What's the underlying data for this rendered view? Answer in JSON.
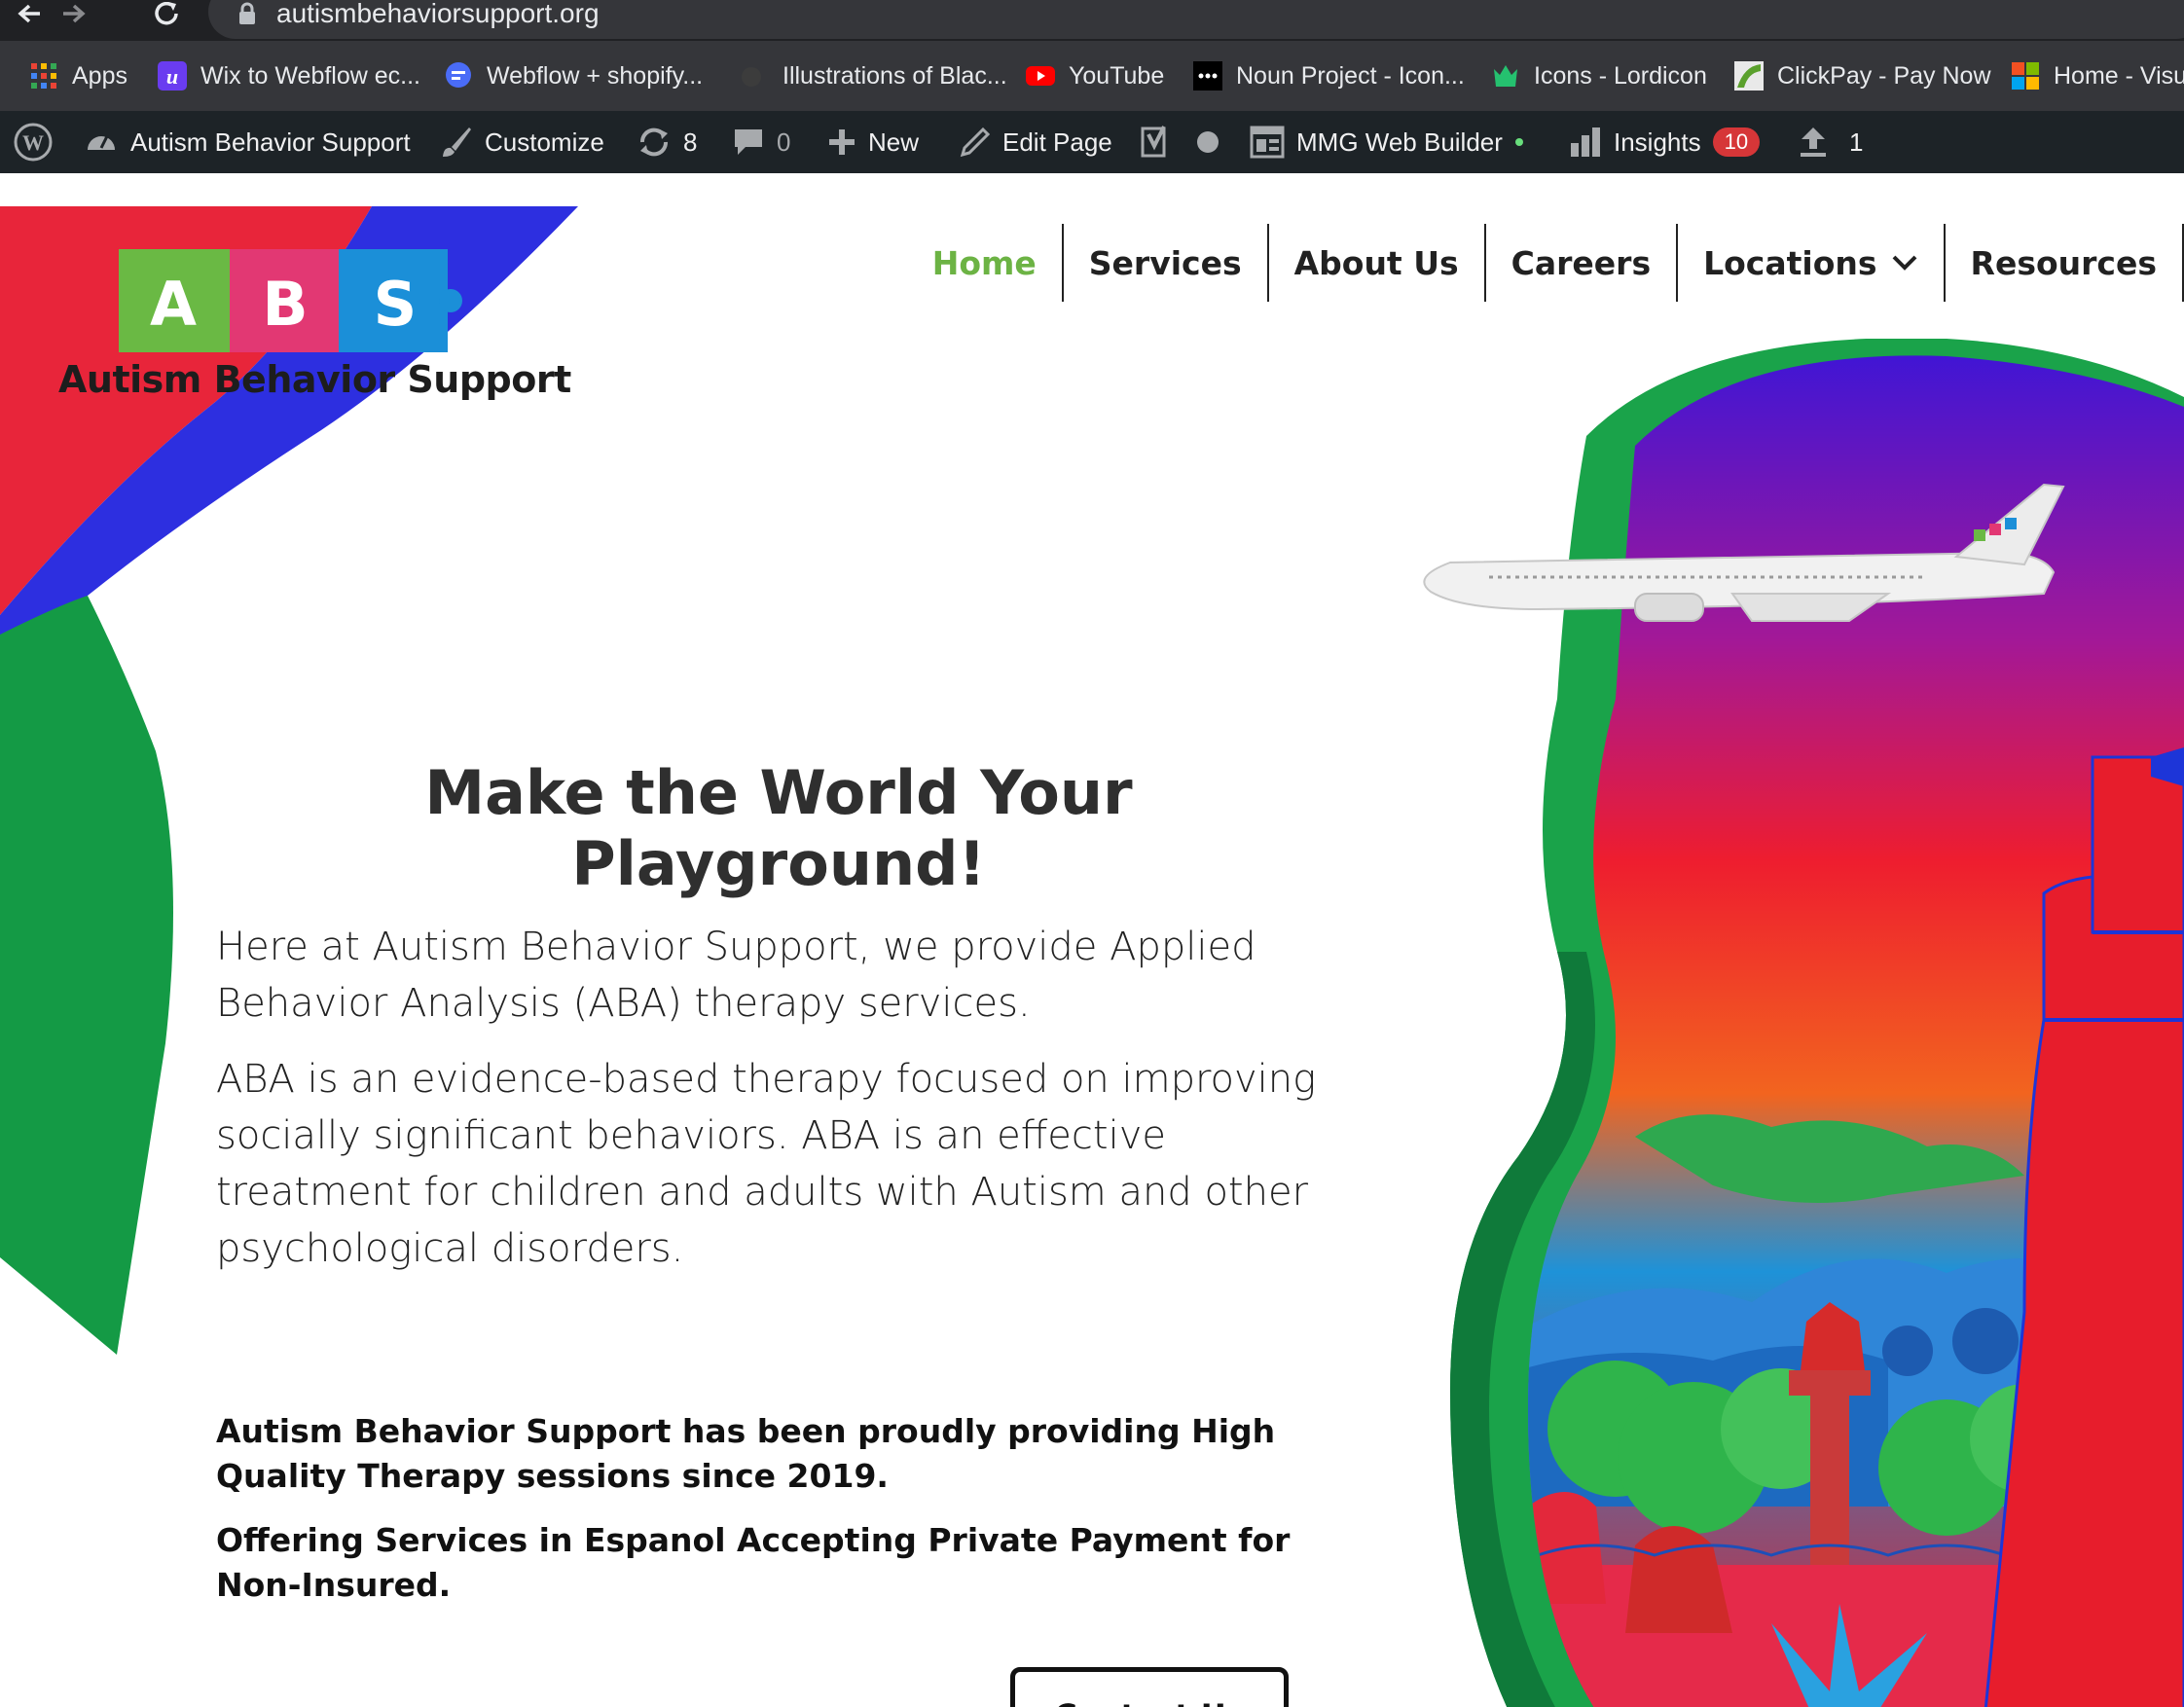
{
  "browser": {
    "url": "autismbehaviorsupport.org",
    "bookmarks": [
      {
        "label": "Apps",
        "icon": "apps-grid-icon"
      },
      {
        "label": "Wix to Webflow ec...",
        "icon": "webflow-u-icon"
      },
      {
        "label": "Webflow + shopify...",
        "icon": "chat-bubble-icon"
      },
      {
        "label": "Illustrations of Blac...",
        "icon": "site-dot-icon"
      },
      {
        "label": "YouTube",
        "icon": "youtube-icon"
      },
      {
        "label": "Noun Project - Icon...",
        "icon": "noun-project-icon"
      },
      {
        "label": "Icons - Lordicon",
        "icon": "lordicon-icon"
      },
      {
        "label": "ClickPay - Pay Now",
        "icon": "clickpay-icon"
      },
      {
        "label": "Home - Visu",
        "icon": "microsoft-icon"
      }
    ]
  },
  "adminbar": {
    "site_name": "Autism Behavior Support",
    "customize": "Customize",
    "updates_count": "8",
    "comments_count": "0",
    "new": "New",
    "edit_page": "Edit Page",
    "builder": "MMG Web Builder",
    "insights": "Insights",
    "insights_badge": "10",
    "uploads_count": "1"
  },
  "site": {
    "logo_letters": [
      "A",
      "B",
      "S"
    ],
    "logo_text": "Autism Behavior Support",
    "nav": [
      {
        "label": "Home",
        "active": true
      },
      {
        "label": "Services"
      },
      {
        "label": "About Us"
      },
      {
        "label": "Careers"
      },
      {
        "label": "Locations",
        "dropdown": true
      },
      {
        "label": "Resources"
      }
    ],
    "hero_title": "Make the World Your Playground!",
    "paragraph1": "Here at Autism Behavior Support, we provide Applied Behavior Analysis (ABA) therapy services.",
    "paragraph2": "ABA is an evidence-based therapy focused on improving socially significant behaviors. ABA is an effective treatment for children and adults with Autism and other psychological disorders.",
    "highlight1": "Autism Behavior Support has been proudly providing High Quality Therapy sessions since 2019.",
    "highlight2": "Offering Services in Espanol Accepting Private Payment for Non-Insured.",
    "cta_label": "Contact Us"
  },
  "colors": {
    "brand_green": "#6cb344",
    "red": "#e8253a",
    "blue": "#2d2fe0",
    "dark_green": "#149a45"
  }
}
